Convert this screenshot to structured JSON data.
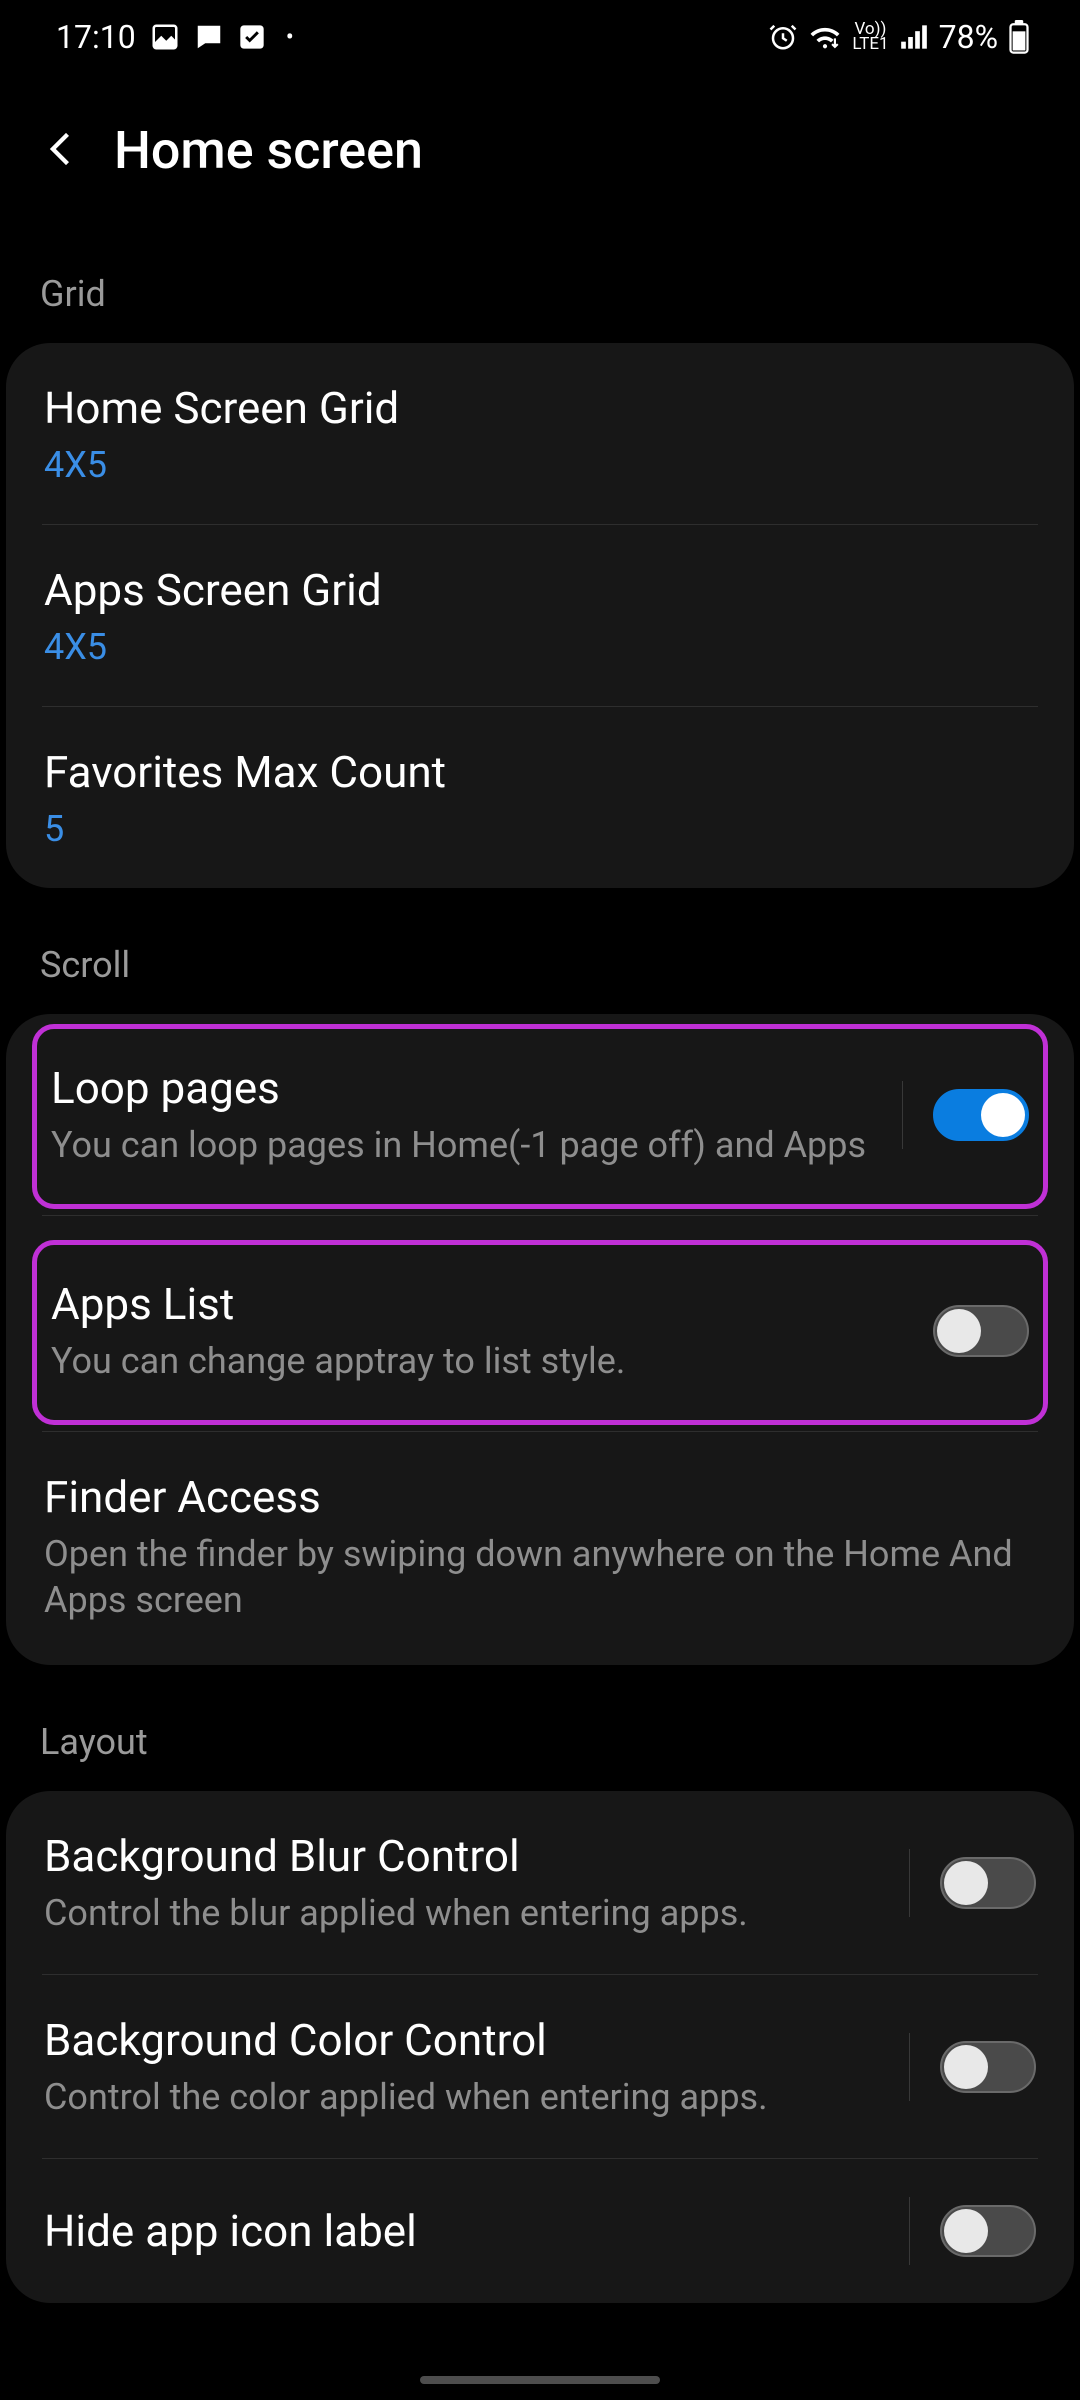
{
  "statusBar": {
    "time": "17:10",
    "battery": "78%",
    "network": "LTE1",
    "volte": "Vo))"
  },
  "header": {
    "title": "Home screen"
  },
  "sections": {
    "grid": {
      "label": "Grid",
      "rows": {
        "homeGrid": {
          "title": "Home Screen Grid",
          "value": "4X5"
        },
        "appsGrid": {
          "title": "Apps Screen Grid",
          "value": "4X5"
        },
        "favMax": {
          "title": "Favorites Max Count",
          "value": "5"
        }
      }
    },
    "scroll": {
      "label": "Scroll",
      "rows": {
        "loop": {
          "title": "Loop pages",
          "desc": "You can loop pages in Home(-1 page off) and Apps",
          "on": true
        },
        "appsList": {
          "title": "Apps List",
          "desc": "You can change apptray to list style.",
          "on": false
        },
        "finder": {
          "title": "Finder Access",
          "desc": "Open the finder by swiping down anywhere on the Home And Apps screen"
        }
      }
    },
    "layout": {
      "label": "Layout",
      "rows": {
        "blur": {
          "title": "Background Blur Control",
          "desc": "Control the blur applied when entering apps.",
          "on": false
        },
        "color": {
          "title": "Background Color Control",
          "desc": "Control the color applied when entering apps.",
          "on": false
        },
        "hideLabel": {
          "title": "Hide app icon label",
          "on": false
        }
      }
    }
  }
}
